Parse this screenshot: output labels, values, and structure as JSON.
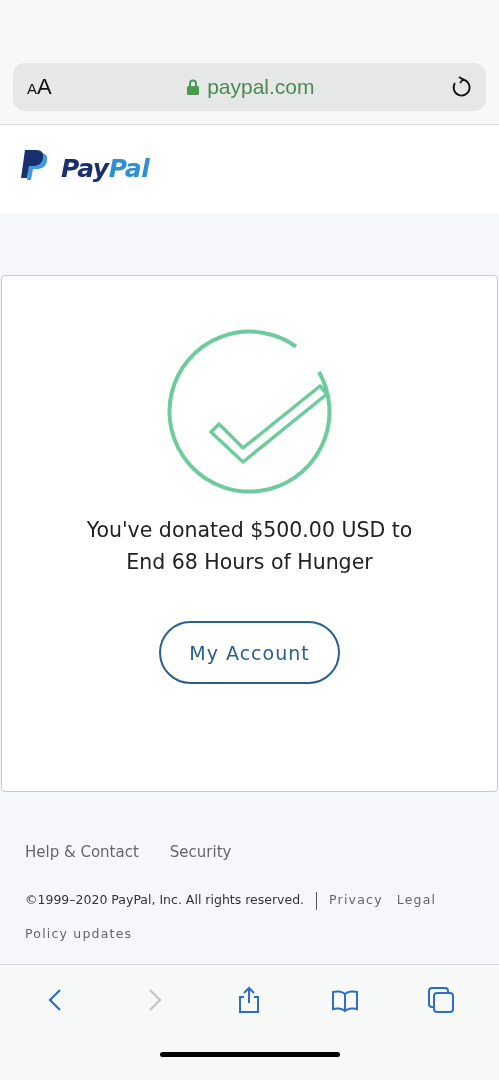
{
  "address_bar": {
    "text_size": "AA",
    "url": "paypal.com",
    "secure": true
  },
  "header": {
    "logo_parts": [
      "Pay",
      "Pal"
    ]
  },
  "confirmation": {
    "message": "You've donated $500.00 USD to End 68 Hours of Hunger",
    "button": "My Account"
  },
  "footer": {
    "links": [
      "Help & Contact",
      "Security"
    ],
    "copyright": "©1999–2020  PayPal, Inc. All rights reserved.",
    "legal_links": [
      "Privacy",
      "Legal",
      "Policy updates"
    ]
  },
  "toolbar": [
    {
      "kind": "back",
      "disabled": false
    },
    {
      "kind": "forward",
      "disabled": true
    },
    {
      "kind": "share",
      "disabled": false
    },
    {
      "kind": "bookmarks",
      "disabled": false
    },
    {
      "kind": "tabs",
      "disabled": false
    }
  ]
}
